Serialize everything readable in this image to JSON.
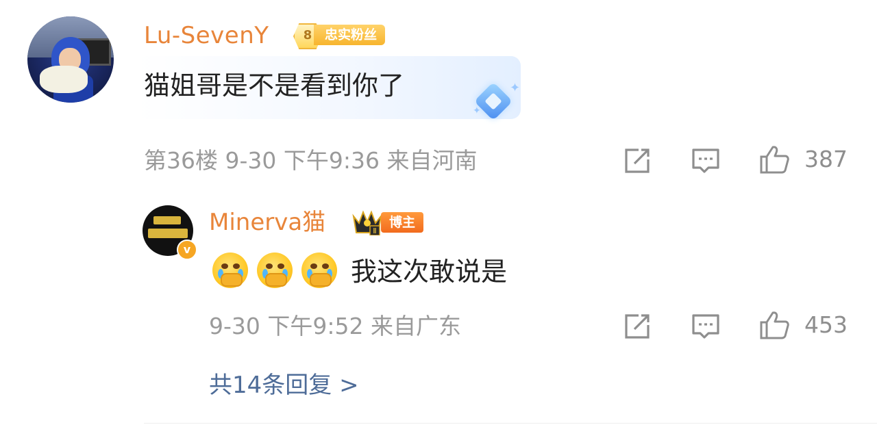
{
  "comment": {
    "username": "Lu-SevenY",
    "fan_level": "8",
    "fan_badge": "忠实粉丝",
    "text": "猫姐哥是不是看到你了",
    "meta": "第36楼 9-30 下午9:36 来自河南",
    "likes": "387",
    "icons": {
      "share": "share-icon",
      "comment": "comment-icon",
      "like": "thumbs-up-icon"
    }
  },
  "reply": {
    "username": "Minerva猫",
    "role_badge": "博主",
    "text": "我这次敢说是",
    "emoji_count": 3,
    "meta": "9-30 下午9:52 来自广东",
    "likes": "453",
    "more_link": "共14条回复 >"
  },
  "colors": {
    "username": "#e8853a",
    "meta": "#9a9a9a",
    "link": "#4e6c98",
    "badge_orange": "#f26b1d",
    "badge_gold": "#f7b52e"
  }
}
